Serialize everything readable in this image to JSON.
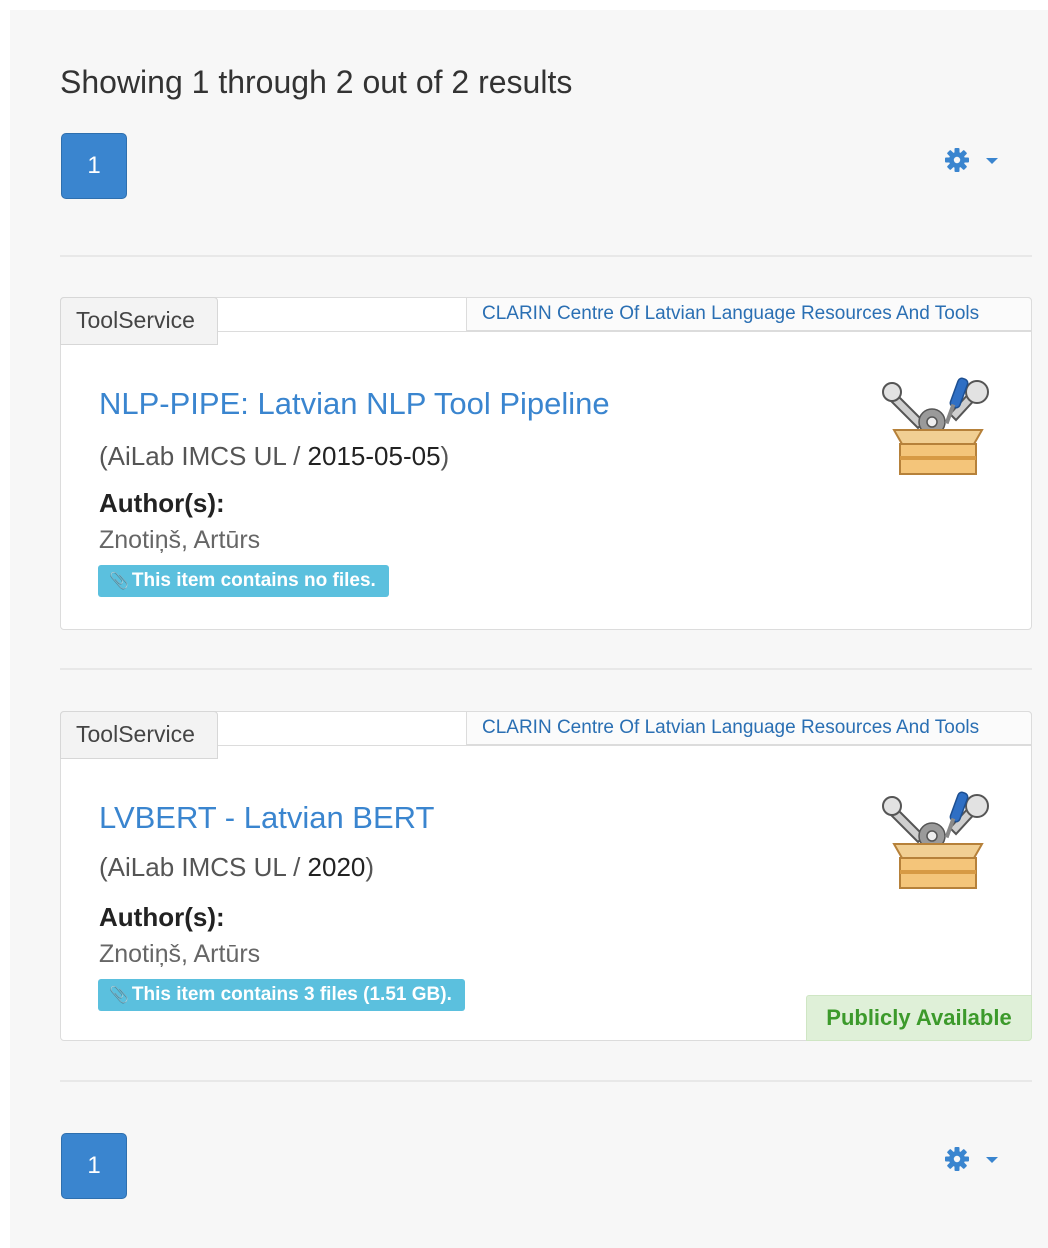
{
  "results": {
    "summary": "Showing 1 through 2 out of 2 results"
  },
  "pagination": {
    "top_page": "1",
    "bottom_page": "1"
  },
  "items": [
    {
      "type": "ToolService",
      "organization": "CLARIN Centre Of Latvian Language Resources And Tools",
      "title": "NLP-PIPE: Latvian NLP Tool Pipeline",
      "publisher": "(AiLab IMCS UL / ",
      "date": "2015-05-05",
      "date_close": ")",
      "authors_label": "Author(s):",
      "author": "Znotiņš, Artūrs",
      "files_note": "This item contains no files.",
      "availability": ""
    },
    {
      "type": "ToolService",
      "organization": "CLARIN Centre Of Latvian Language Resources And Tools",
      "title": "LVBERT - Latvian BERT",
      "publisher": "(AiLab IMCS UL / ",
      "date": "2020",
      "date_close": ")",
      "authors_label": "Author(s):",
      "author": "Znotiņš, Artūrs",
      "files_note": "This item contains 3 files (1.51 GB).",
      "availability": "Publicly Available"
    }
  ],
  "icons": {
    "settings": "gear-icon",
    "dropdown": "caret-down-icon",
    "attachment": "paperclip-icon",
    "item_type": "toolbox-icon"
  },
  "colors": {
    "primary": "#3a85cf",
    "info": "#5bc0de",
    "success_bg": "#dff0d8",
    "success_text": "#3c9a2b"
  }
}
